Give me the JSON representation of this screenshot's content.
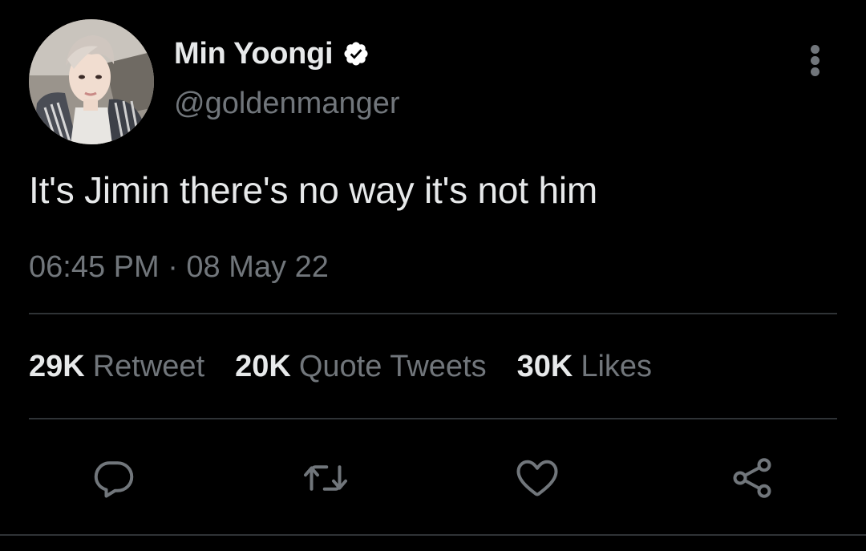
{
  "tweet": {
    "display_name": "Min Yoongi",
    "handle": "@goldenmanger",
    "text": "It's Jimin there's no way it's not him",
    "timestamp": "06:45 PM · 08 May 22",
    "verified": true
  },
  "stats": [
    {
      "count": "29K",
      "label": "Retweet"
    },
    {
      "count": "20K",
      "label": "Quote Tweets"
    },
    {
      "count": "30K",
      "label": "Likes"
    }
  ],
  "actions": [
    {
      "icon": "reply-icon"
    },
    {
      "icon": "retweet-icon"
    },
    {
      "icon": "like-icon"
    },
    {
      "icon": "share-icon"
    }
  ],
  "menu": {
    "icon": "more-vertical-icon"
  },
  "colors": {
    "background": "#000000",
    "primary_text": "#e7e9ea",
    "secondary_text": "#71767b",
    "divider": "#2f3336",
    "verified_badge": "#ffffff"
  }
}
